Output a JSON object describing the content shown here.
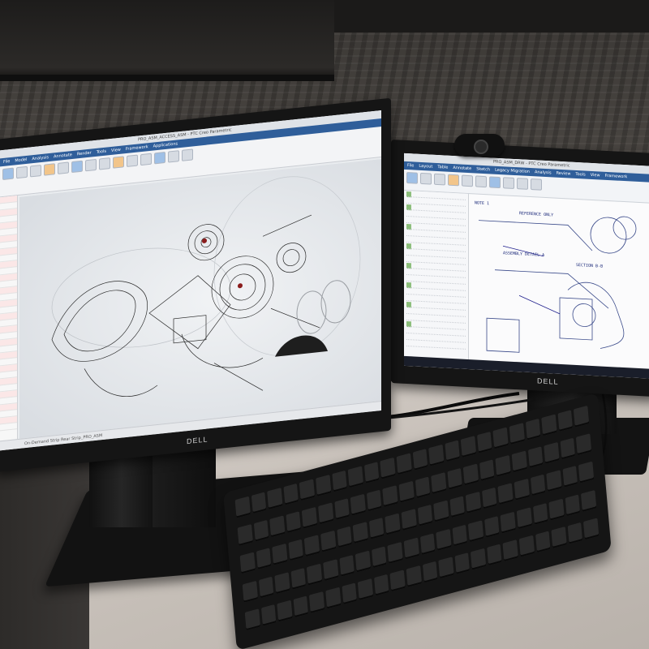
{
  "scene": {
    "left_monitor": {
      "brand": "DELL",
      "app_title": "PRO_ASM_ACCESS_ASM - PTC Creo Parametric",
      "menu_tabs": [
        "File",
        "Model",
        "Analysis",
        "Annotate",
        "Render",
        "Tools",
        "View",
        "Framework",
        "Applications"
      ],
      "status_text": "On-Demand Strip Rear Strip_PRO_ASM"
    },
    "right_monitor": {
      "brand": "DELL",
      "app_title": "PRO_ASM_DRW - PTC Creo Parametric",
      "menu_tabs": [
        "File",
        "Layout",
        "Table",
        "Annotate",
        "Sketch",
        "Legacy Migration",
        "Analysis",
        "Review",
        "Tools",
        "View",
        "Framework"
      ]
    },
    "keyboard": {
      "key_count": 110
    },
    "colors": {
      "ribbon_blue": "#2f5e9a",
      "screen_bg": "#e9ecef",
      "desk": "#cfc8c1",
      "bezel": "#151515"
    }
  }
}
